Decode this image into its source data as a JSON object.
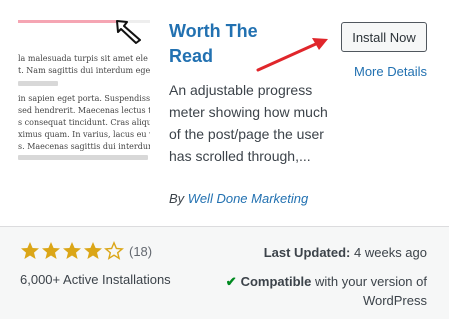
{
  "plugin": {
    "title": "Worth The Read",
    "install_label": "Install Now",
    "more_details_label": "More Details",
    "description": "An adjustable progress meter showing how much of the post/page the user has scrolled through,...",
    "author_prefix": "By ",
    "author_name": "Well Done Marketing"
  },
  "thumbnail": {
    "lines": [
      "la malesuada turpis sit amet ele",
      "t. Nam sagittis dui interdum egestas l",
      "in sapien eget porta. Suspendisse ru",
      "sed hendrerit. Maecenas lectus tellus,",
      "s consequat tincidunt. Cras aliqua",
      "ximus quam. In varius, lacus eu viverr",
      "s. Maecenas sagittis dui interdum"
    ]
  },
  "footer": {
    "rating": 4,
    "rating_count": "(18)",
    "installs": "6,000+ Active Installations",
    "last_updated_label": "Last Updated:",
    "last_updated_value": " 4 weeks ago",
    "compat_strong": "Compatible",
    "compat_rest": " with your version of WordPress"
  },
  "colors": {
    "link": "#2271b1",
    "star": "#dba617",
    "check": "#008a20",
    "annotation_arrow": "#e0262b"
  }
}
